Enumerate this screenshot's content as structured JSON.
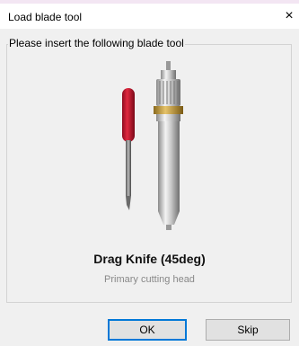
{
  "window": {
    "title": "Load blade tool",
    "close_glyph": "×"
  },
  "group": {
    "legend": "Please insert the following blade tool"
  },
  "tool": {
    "name": "Drag Knife (45deg)",
    "description": "Primary cutting head",
    "image_icon": "blade-tool-image"
  },
  "buttons": {
    "ok_label": "OK",
    "skip_label": "Skip"
  },
  "colors": {
    "accent": "#0078d7",
    "cap_red": "#c8102e",
    "dialog_bg": "#f0f0f0"
  }
}
